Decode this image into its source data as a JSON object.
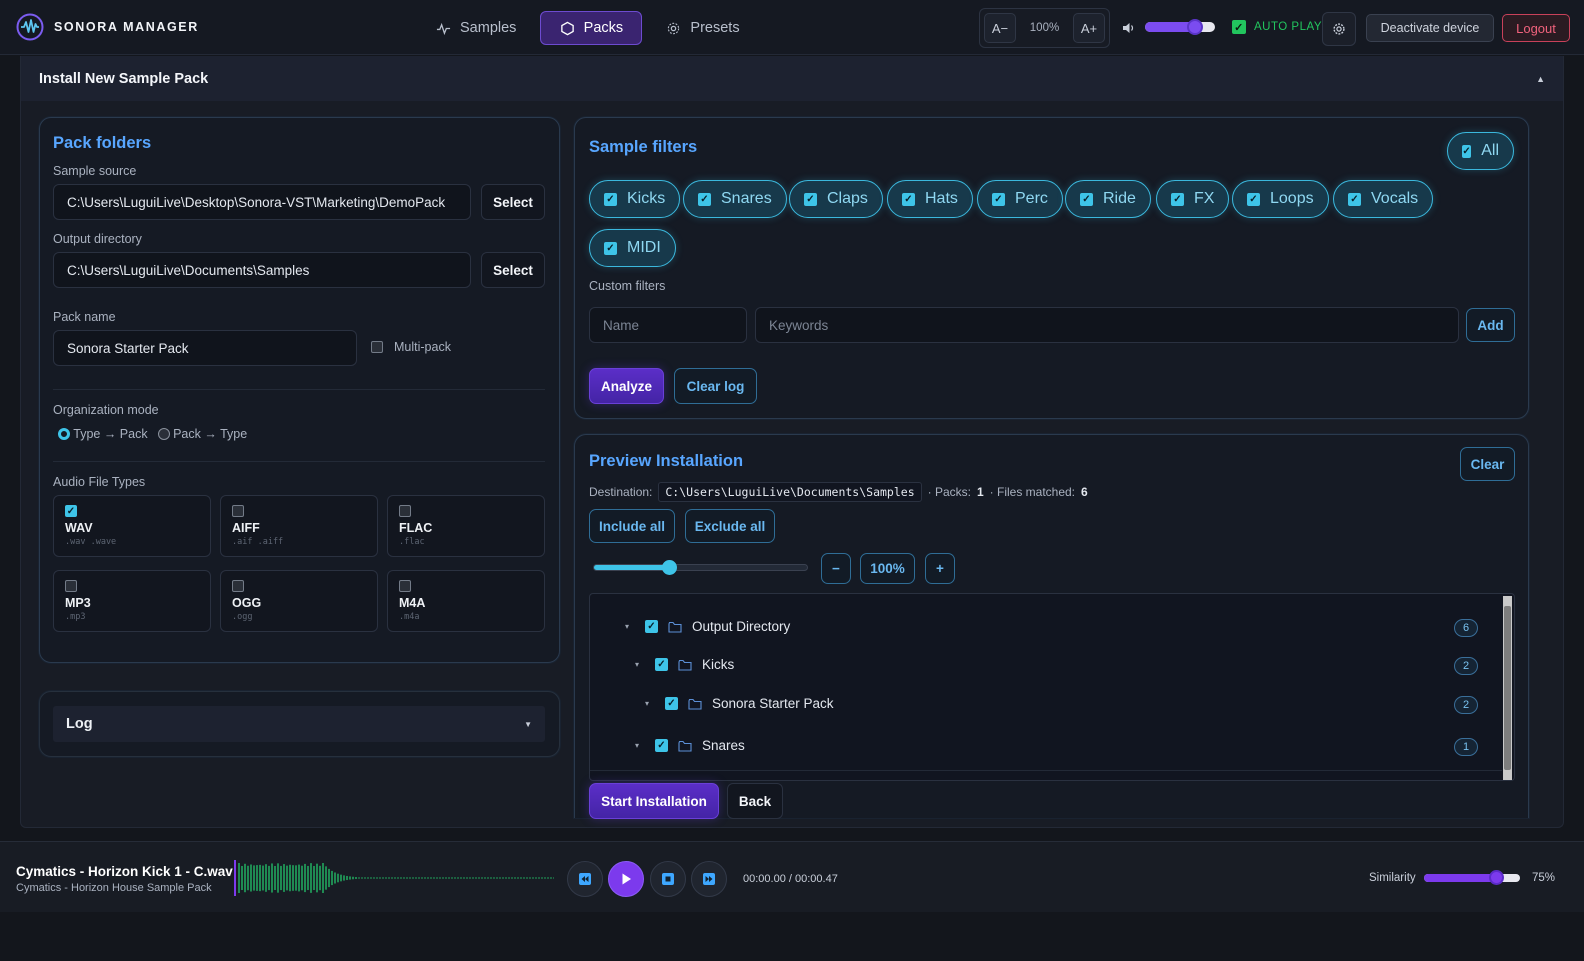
{
  "app": {
    "name": "SONORA MANAGER"
  },
  "nav": [
    {
      "label": "Samples",
      "icon": "pulse-icon",
      "active": false
    },
    {
      "label": "Packs",
      "icon": "hexagon-icon",
      "active": true
    },
    {
      "label": "Presets",
      "icon": "gear-icon",
      "active": false
    }
  ],
  "toolbar": {
    "zoom_out": "A−",
    "zoom_value": "100%",
    "zoom_in": "A+",
    "volume": 0.72,
    "autoplay_label": "AUTO PLAY",
    "autoplay_checked": true,
    "deactivate_label": "Deactivate device",
    "logout_label": "Logout"
  },
  "install": {
    "title": "Install New Sample Pack",
    "pack_folders": {
      "title": "Pack folders",
      "sample_source_label": "Sample source",
      "sample_source_value": "C:\\Users\\LuguiLive\\Desktop\\Sonora-VST\\Marketing\\DemoPack",
      "select_label": "Select",
      "output_dir_label": "Output directory",
      "output_dir_value": "C:\\Users\\LuguiLive\\Documents\\Samples",
      "pack_name_label": "Pack name",
      "pack_name_value": "Sonora Starter Pack",
      "multipack_label": "Multi-pack",
      "org_mode_label": "Organization mode",
      "org_modes": [
        "Type → Pack",
        "Pack → Type"
      ],
      "audio_types_label": "Audio File Types",
      "file_types": [
        {
          "name": "WAV",
          "ext": ".wav .wave",
          "checked": true
        },
        {
          "name": "AIFF",
          "ext": ".aif .aiff",
          "checked": false
        },
        {
          "name": "FLAC",
          "ext": ".flac",
          "checked": false
        },
        {
          "name": "MP3",
          "ext": ".mp3",
          "checked": false
        },
        {
          "name": "OGG",
          "ext": ".ogg",
          "checked": false
        },
        {
          "name": "M4A",
          "ext": ".m4a",
          "checked": false
        }
      ]
    },
    "log": {
      "label": "Log"
    },
    "filters": {
      "title": "Sample filters",
      "all_label": "All",
      "chips": [
        "Kicks",
        "Snares",
        "Claps",
        "Hats",
        "Perc",
        "Ride",
        "FX",
        "Loops",
        "Vocals",
        "MIDI"
      ],
      "custom_label": "Custom filters",
      "name_placeholder": "Name",
      "keywords_placeholder": "Keywords",
      "add_label": "Add",
      "analyze_label": "Analyze",
      "clear_log_label": "Clear log"
    },
    "preview": {
      "title": "Preview Installation",
      "clear_label": "Clear",
      "destination_label": "Destination:",
      "destination_value": "C:\\Users\\LuguiLive\\Documents\\Samples",
      "packs_label": "· Packs:",
      "packs_value": "1",
      "files_label": "· Files matched:",
      "files_value": "6",
      "include_all": "Include all",
      "exclude_all": "Exclude all",
      "zoom_minus": "−",
      "zoom_value": "100%",
      "zoom_plus": "+",
      "zoom_level": 0.35,
      "tree": [
        {
          "label": "Output Directory",
          "count": "6",
          "depth": 0
        },
        {
          "label": "Kicks",
          "count": "2",
          "depth": 1
        },
        {
          "label": "Sonora Starter Pack",
          "count": "2",
          "depth": 2
        },
        {
          "label": "Snares",
          "count": "1",
          "depth": 1
        }
      ],
      "start_label": "Start Installation",
      "back_label": "Back"
    }
  },
  "player": {
    "title": "Cymatics - Horizon Kick 1 - C.wav",
    "subtitle": "Cymatics - Horizon House Sample Pack",
    "time": "00:00.00 / 00:00.47",
    "similarity_label": "Similarity",
    "similarity_value": "75%",
    "similarity_level": 0.75
  },
  "colors": {
    "accent_purple": "#7c3aed",
    "accent_cyan": "#3ec4e8",
    "accent_blue": "#58a6ff",
    "logout_red": "#f0627c",
    "autoplay_green": "#22c55e"
  }
}
